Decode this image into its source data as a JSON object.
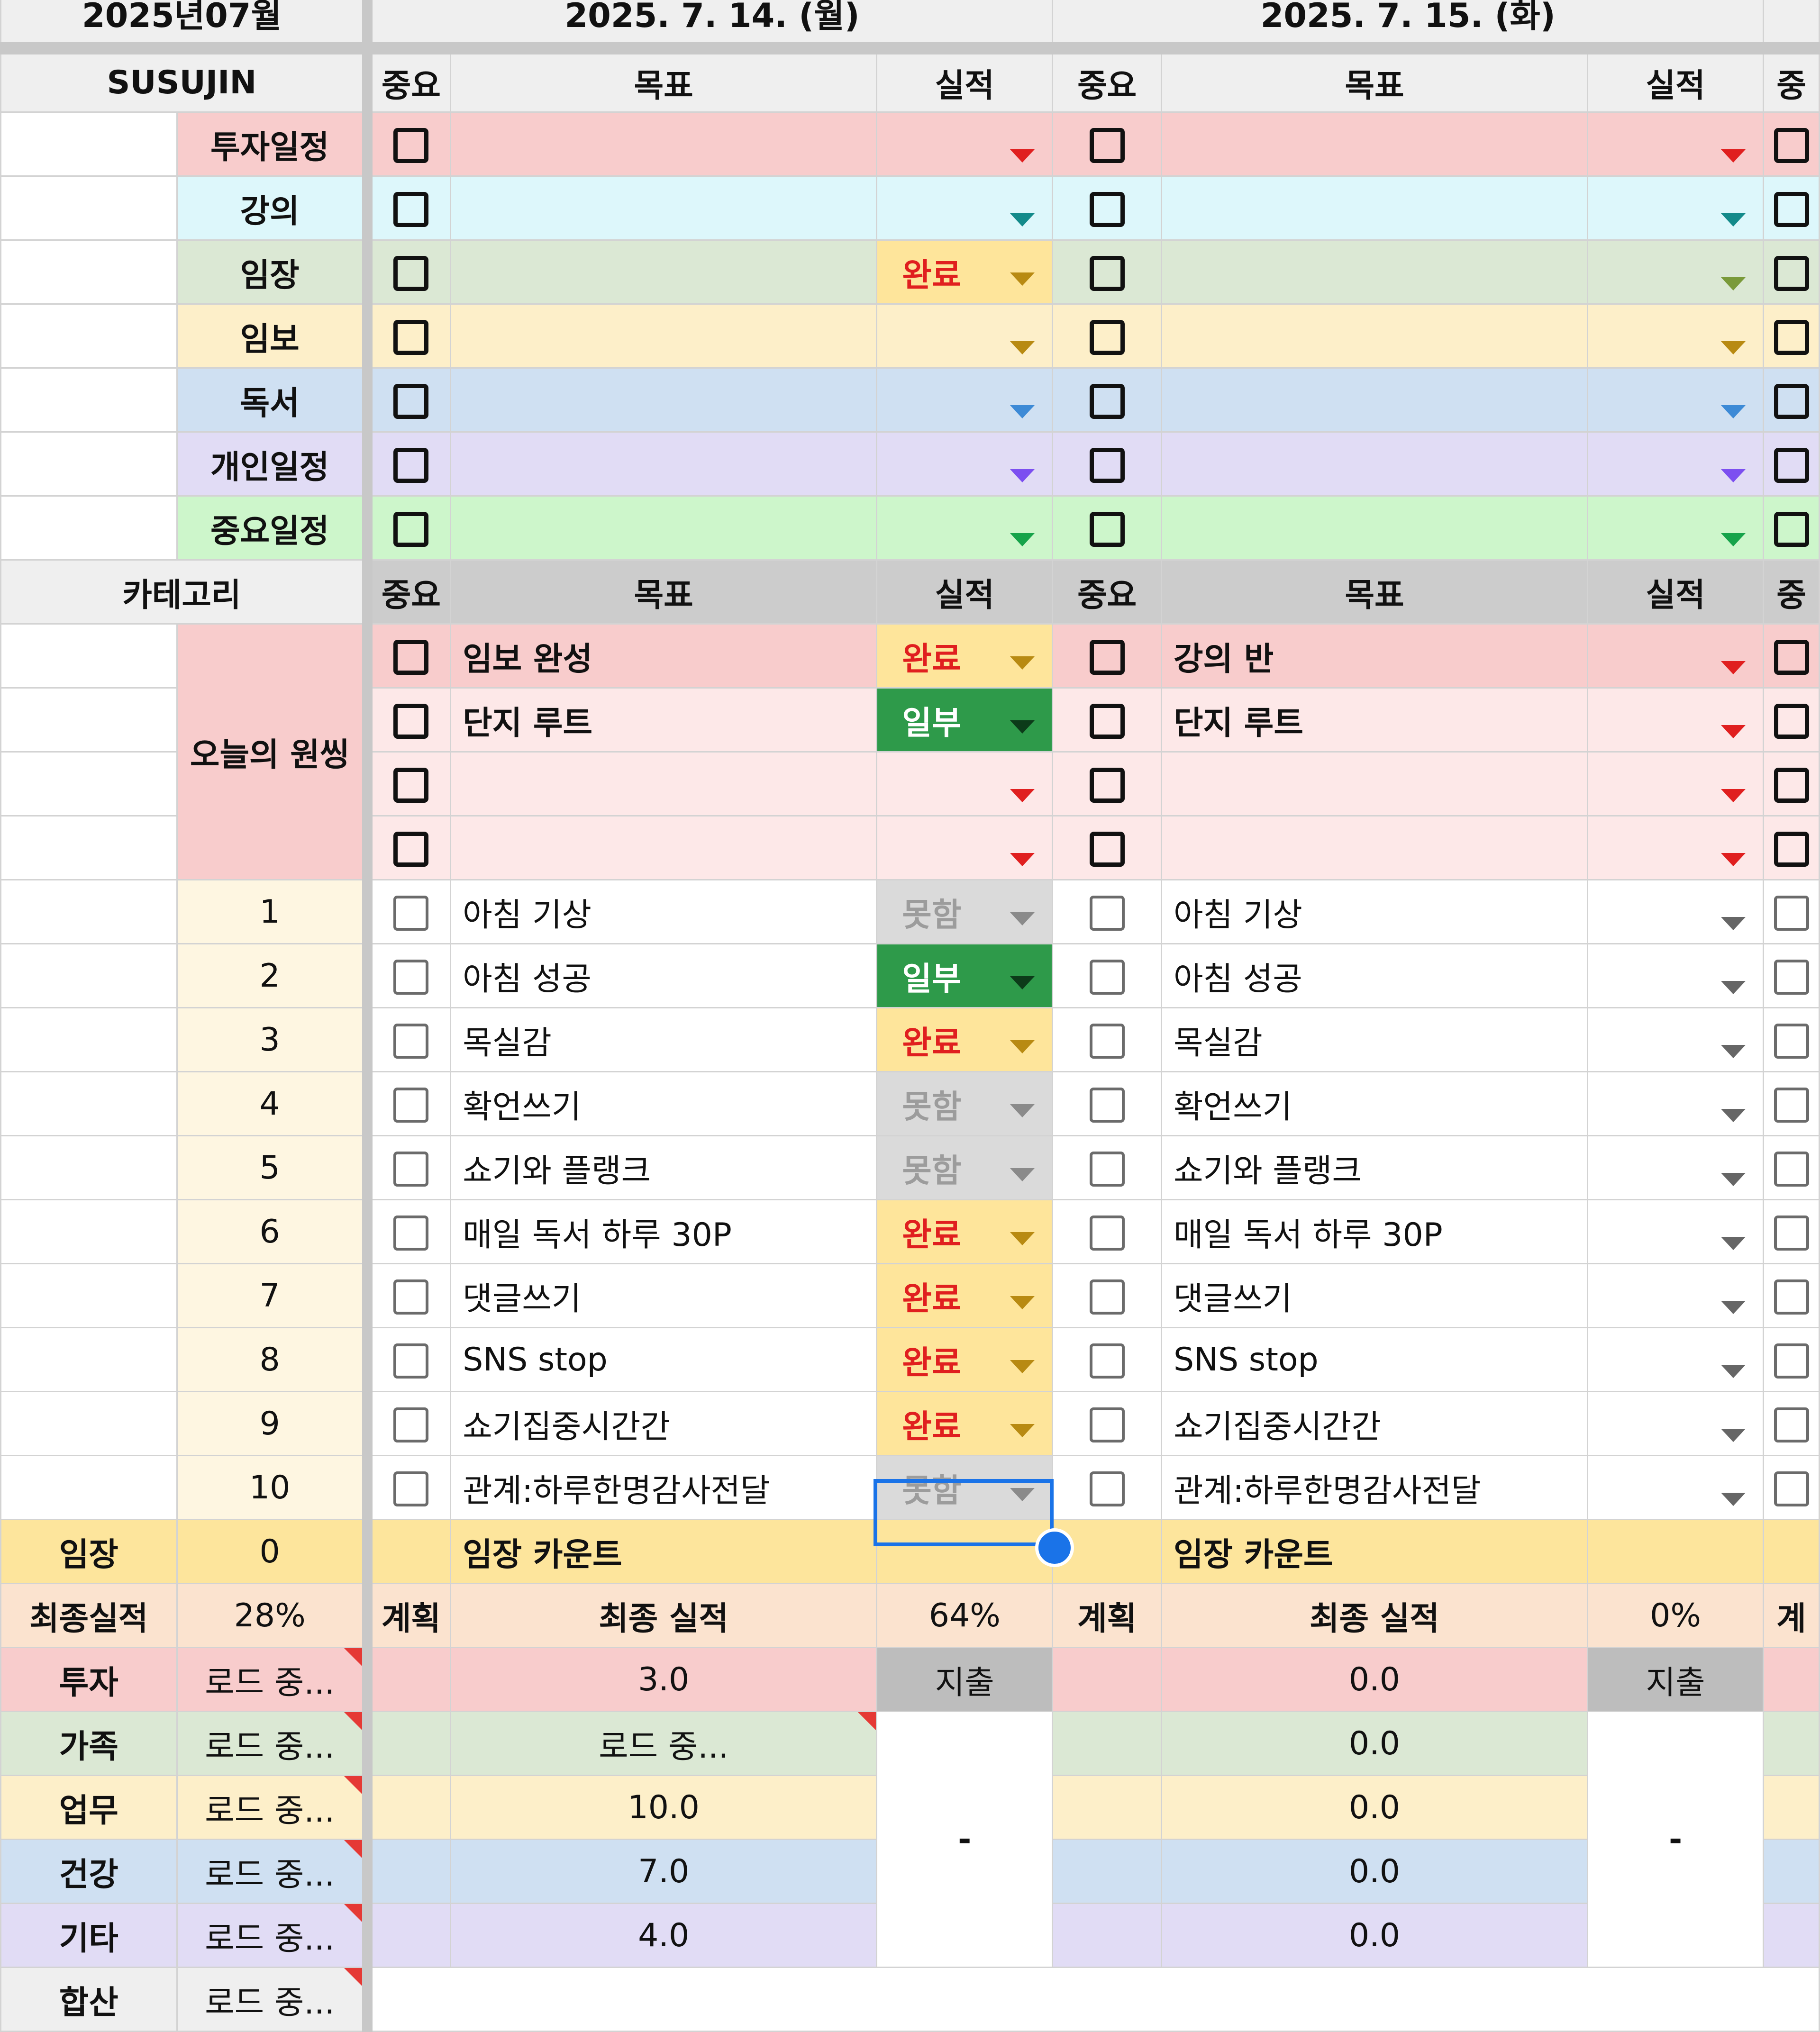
{
  "colors": {
    "invest": "#f8cccc",
    "lecture": "#ddf7fb",
    "imjang": "#dbe8d4",
    "imbo": "#fdefc9",
    "reading": "#cfe0f2",
    "personal": "#e1dcf5",
    "important": "#cdf6cb",
    "wish_main": "#f8cccc",
    "wish_light": "#fde8e8",
    "done_bg": "#fee59b",
    "done_fg": "#e01f1f",
    "partial_bg": "#2e9a4a",
    "partial_fg": "#ffffff",
    "fail_bg": "#dadada",
    "fail_fg": "#9c9c9c",
    "yellow_row": "#fde59c",
    "peach_row": "#fbe3cf",
    "num_cell": "#fef6e1",
    "selection": "#1a73e8",
    "spend_bg": "#bdbdbd",
    "note_corner": "#e53935"
  },
  "sheet": {
    "month": "2025년07월",
    "user": "SUSUJIN",
    "category_header": "카테고리",
    "wish_label": "오늘의 원씽",
    "imjang_label": "임장",
    "imjang_value": "0",
    "final_label": "최종실적",
    "final_value": "28%",
    "days": [
      {
        "date": "2025. 7. 14. (월)",
        "final_pct": "64%"
      },
      {
        "date": "2025. 7. 15. (화)",
        "final_pct": "0%"
      }
    ],
    "col_headers": {
      "important": "중요",
      "important_cut": "중요",
      "goal": "목표",
      "result": "실적",
      "important_next": "중"
    },
    "plan_label": "계획",
    "plan_label_cut": "계획",
    "plan_label_next": "계",
    "final_result_label": "최종 실적",
    "imjang_count_label": "임장 카운트",
    "spend_label": "지출",
    "dash": "-"
  },
  "categories": [
    {
      "label": "투자일정",
      "color": "#f8cccc",
      "arrow": "#e01f1f"
    },
    {
      "label": "강의",
      "color": "#ddf7fb",
      "arrow": "#138a8a"
    },
    {
      "label": "임장",
      "color": "#dbe8d4",
      "arrow": "#7a9a3a"
    },
    {
      "label": "임보",
      "color": "#fdefc9",
      "arrow": "#b88a12"
    },
    {
      "label": "독서",
      "color": "#cfe0f2",
      "arrow": "#3d8ad6"
    },
    {
      "label": "개인일정",
      "color": "#e1dcf5",
      "arrow": "#7c4ff0"
    },
    {
      "label": "중요일정",
      "color": "#cdf6cb",
      "arrow": "#16a34a"
    }
  ],
  "category_results_mon": [
    "",
    "",
    "완료",
    "",
    "",
    "",
    ""
  ],
  "wish_rows": [
    {
      "mon_goal": "임보 완성",
      "mon_result": "완료",
      "tue_goal": "강의 반"
    },
    {
      "mon_goal": "단지 루트",
      "mon_result": "일부",
      "tue_goal": "단지 루트"
    },
    {
      "mon_goal": "",
      "mon_result": "",
      "tue_goal": ""
    },
    {
      "mon_goal": "",
      "mon_result": "",
      "tue_goal": ""
    }
  ],
  "habits": [
    {
      "num": "1",
      "goal": "아침 기상",
      "mon_result": "못함"
    },
    {
      "num": "2",
      "goal": "아침 성공",
      "mon_result": "일부"
    },
    {
      "num": "3",
      "goal": "목실감",
      "mon_result": "완료"
    },
    {
      "num": "4",
      "goal": "확언쓰기",
      "mon_result": "못함"
    },
    {
      "num": "5",
      "goal": "쇼기와 플랭크",
      "mon_result": "못함"
    },
    {
      "num": "6",
      "goal": "매일 독서 하루 30P",
      "mon_result": "완료"
    },
    {
      "num": "7",
      "goal": "댓글쓰기",
      "mon_result": "완료"
    },
    {
      "num": "8",
      "goal": "SNS stop",
      "mon_result": "완료"
    },
    {
      "num": "9",
      "goal": "쇼기집중시간간",
      "mon_result": "완료"
    },
    {
      "num": "10",
      "goal": "관계:하루한명감사전달",
      "mon_result": "못함"
    }
  ],
  "budget": [
    {
      "label": "투자",
      "status": "로드 중...",
      "mon": "3.0",
      "tue": "0.0",
      "color": "#f8cccc"
    },
    {
      "label": "가족",
      "status": "로드 중...",
      "mon": "로드 중...",
      "tue": "0.0",
      "color": "#dbe8d4"
    },
    {
      "label": "업무",
      "status": "로드 중...",
      "mon": "10.0",
      "tue": "0.0",
      "color": "#fdefc9"
    },
    {
      "label": "건강",
      "status": "로드 중...",
      "mon": "7.0",
      "tue": "0.0",
      "color": "#cfe0f2"
    },
    {
      "label": "기타",
      "status": "로드 중...",
      "mon": "4.0",
      "tue": "0.0",
      "color": "#e1dcf5"
    },
    {
      "label": "합산",
      "status": "로드 중...",
      "color": "#efefef"
    }
  ]
}
